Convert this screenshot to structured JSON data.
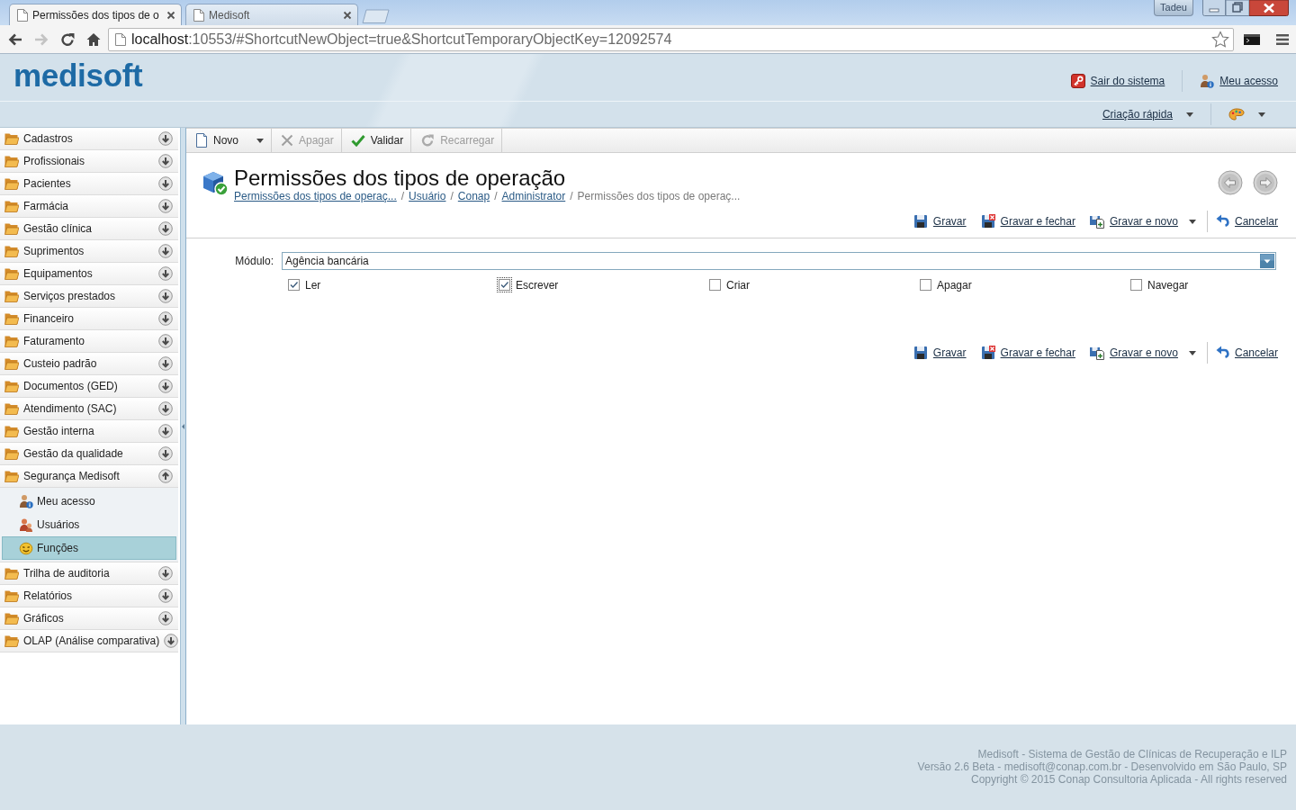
{
  "browser": {
    "tabs": [
      {
        "title": "Permissões dos tipos de o",
        "selected": true
      },
      {
        "title": "Medisoft",
        "selected": false
      }
    ],
    "profile": "Tadeu",
    "nav_buttons": [
      {
        "kind": "back",
        "disabled": false
      },
      {
        "kind": "forward",
        "disabled": true
      },
      {
        "kind": "reload",
        "disabled": false
      },
      {
        "kind": "home",
        "disabled": false
      }
    ],
    "url": {
      "host": "localhost",
      "path": ":10553/#ShortcutNewObject=true&ShortcutTemporaryObjectKey=12092574"
    }
  },
  "header": {
    "logo": "medisoft",
    "links": [
      {
        "label": "Sair do sistema",
        "kind": "logout"
      },
      {
        "label": "Meu acesso",
        "kind": "profile"
      }
    ],
    "quick_create": "Criação rápida"
  },
  "sidebar": {
    "items": [
      {
        "label": "Cadastros",
        "expanded": false
      },
      {
        "label": "Profissionais",
        "expanded": false
      },
      {
        "label": "Pacientes",
        "expanded": false
      },
      {
        "label": "Farmácia",
        "expanded": false
      },
      {
        "label": "Gestão clínica",
        "expanded": false
      },
      {
        "label": "Suprimentos",
        "expanded": false
      },
      {
        "label": "Equipamentos",
        "expanded": false
      },
      {
        "label": "Serviços prestados",
        "expanded": false
      },
      {
        "label": "Financeiro",
        "expanded": false
      },
      {
        "label": "Faturamento",
        "expanded": false
      },
      {
        "label": "Custeio padrão",
        "expanded": false
      },
      {
        "label": "Documentos (GED)",
        "expanded": false
      },
      {
        "label": "Atendimento (SAC)",
        "expanded": false
      },
      {
        "label": "Gestão interna",
        "expanded": false
      },
      {
        "label": "Gestão da qualidade",
        "expanded": false
      },
      {
        "label": "Segurança Medisoft",
        "expanded": true,
        "children": [
          {
            "label": "Meu acesso",
            "kind": "profile",
            "selected": false
          },
          {
            "label": "Usuários",
            "kind": "users",
            "selected": false
          },
          {
            "label": "Funções",
            "kind": "roles",
            "selected": true
          }
        ]
      },
      {
        "label": "Trilha de auditoria",
        "expanded": false
      },
      {
        "label": "Relatórios",
        "expanded": false
      },
      {
        "label": "Gráficos",
        "expanded": false
      },
      {
        "label": "OLAP (Análise comparativa)",
        "expanded": false
      }
    ]
  },
  "toolbar": [
    {
      "label": "Novo",
      "kind": "new",
      "disabled": false,
      "has_menu": true
    },
    {
      "label": "Apagar",
      "kind": "delete",
      "disabled": true,
      "has_menu": false
    },
    {
      "label": "Validar",
      "kind": "validate",
      "disabled": false,
      "has_menu": false
    },
    {
      "label": "Recarregar",
      "kind": "reload",
      "disabled": true,
      "has_menu": false
    }
  ],
  "page": {
    "title": "Permissões dos tipos de operação",
    "breadcrumb": [
      {
        "label": "Permissões dos tipos de operaç...",
        "link": true
      },
      {
        "separator": "/",
        "label": "Usuário",
        "link": true
      },
      {
        "separator": "/",
        "label": "Conap",
        "link": true
      },
      {
        "separator": "/",
        "label": "Administrator",
        "link": true
      },
      {
        "separator": "/",
        "label": "Permissões dos tipos de operaç...",
        "link": false
      }
    ]
  },
  "actions_top": [
    {
      "label": "Gravar",
      "kind": "save",
      "has_menu": false
    },
    {
      "label": "Gravar e fechar",
      "kind": "save-close",
      "has_menu": false
    },
    {
      "label": "Gravar e novo",
      "kind": "save-new",
      "has_menu": true
    },
    {
      "label": "Cancelar",
      "kind": "cancel",
      "has_menu": false
    }
  ],
  "form": {
    "module": {
      "label": "Módulo:",
      "value": "Agência bancária"
    },
    "permissions": [
      {
        "label": "Ler",
        "checked": true,
        "focused": false
      },
      {
        "label": "Escrever",
        "checked": true,
        "focused": true
      },
      {
        "label": "Criar",
        "checked": false,
        "focused": false
      },
      {
        "label": "Apagar",
        "checked": false,
        "focused": false
      },
      {
        "label": "Navegar",
        "checked": false,
        "focused": false
      }
    ]
  },
  "actions_bottom": [
    {
      "label": "Gravar",
      "kind": "save",
      "has_menu": false
    },
    {
      "label": "Gravar e fechar",
      "kind": "save-close",
      "has_menu": false
    },
    {
      "label": "Gravar e novo",
      "kind": "save-new",
      "has_menu": true
    },
    {
      "label": "Cancelar",
      "kind": "cancel",
      "has_menu": false
    }
  ],
  "footer": [
    "Medisoft - Sistema de Gestão de Clínicas de Recuperação e ILP",
    "Versão 2.6 Beta - medisoft@conap.com.br - Desenvolvido em São Paulo, SP",
    "Copyright © 2015 Conap Consultoria Aplicada - All rights reserved"
  ]
}
